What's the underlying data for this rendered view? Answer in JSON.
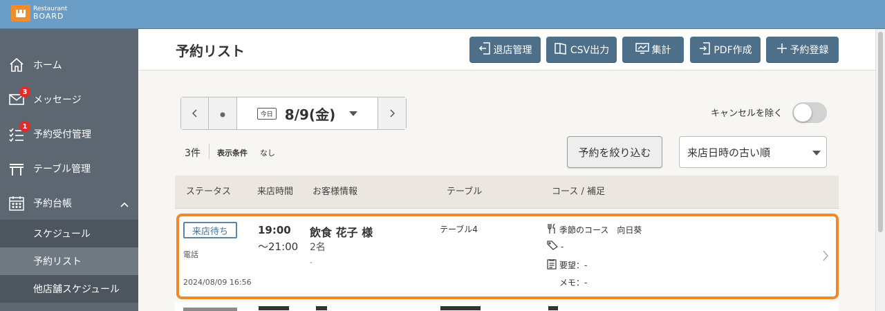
{
  "app": {
    "logo_line1": "Restaurant",
    "logo_line2": "BOARD",
    "accent_color": "#6a9ec6",
    "highlight_color": "#ee8a2b"
  },
  "sidebar": {
    "items": [
      {
        "label": "ホーム",
        "icon": "home-icon"
      },
      {
        "label": "メッセージ",
        "icon": "mail-icon",
        "badge": "3"
      },
      {
        "label": "予約受付管理",
        "icon": "checklist-icon",
        "badge": "1"
      },
      {
        "label": "テーブル管理",
        "icon": "table-icon"
      },
      {
        "label": "予約台帳",
        "icon": "calendar-icon"
      }
    ],
    "sub_items": [
      {
        "label": "スケジュール"
      },
      {
        "label": "予約リスト"
      },
      {
        "label": "他店舗スケジュール"
      }
    ]
  },
  "header": {
    "title": "予約リスト",
    "buttons": [
      {
        "label": "退店管理",
        "icon": "exit-icon"
      },
      {
        "label": "CSV出力",
        "icon": "book-icon"
      },
      {
        "label": "集計",
        "icon": "monitor-chart-icon"
      },
      {
        "label": "PDF作成",
        "icon": "document-export-icon"
      },
      {
        "label": "予約登録",
        "icon": "plus-icon"
      }
    ]
  },
  "date_nav": {
    "today_label": "今日",
    "date": "8/9(金)"
  },
  "cancel_toggle": {
    "label": "キャンセルを除く",
    "on": false
  },
  "filter": {
    "count": "3件",
    "condition_label": "表示条件",
    "condition_value": "なし",
    "filter_button": "予約を絞り込む",
    "sort_selected": "来店日時の古い順"
  },
  "table": {
    "headers": [
      "ステータス",
      "来店時間",
      "お客様情報",
      "テーブル",
      "コース / 補足"
    ],
    "rows": [
      {
        "status": "来店待ち",
        "source": "電話",
        "created": "2024/08/09 16:56",
        "time_start": "19:00",
        "time_end": "〜21:00",
        "customer_name": "飲食 花子 様",
        "party_size": "2名",
        "customer_extra": "-",
        "table": "テーブル4",
        "course": "季節のコース　向日葵",
        "tag": "-",
        "request": "要望：-",
        "memo": "メモ：-"
      }
    ]
  }
}
